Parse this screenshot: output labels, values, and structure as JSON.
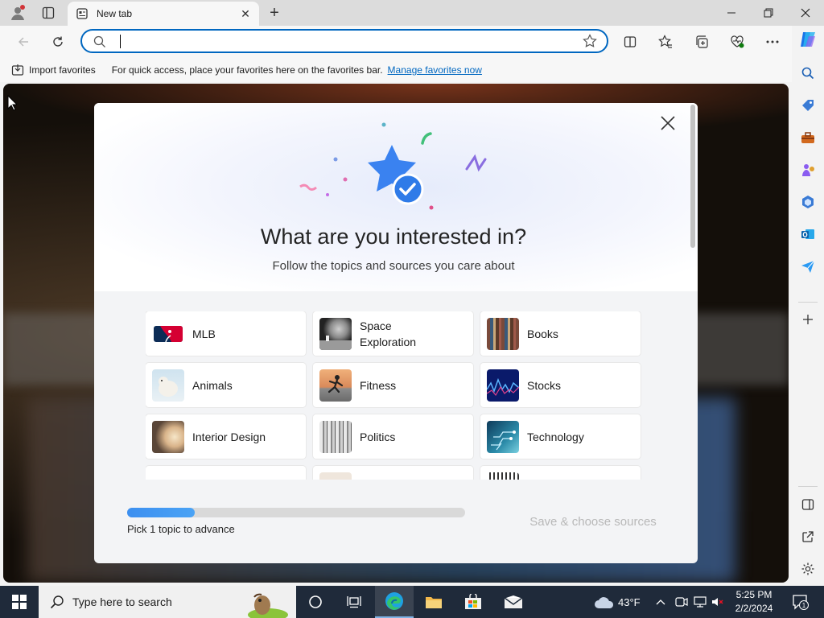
{
  "browser": {
    "tab": {
      "title": "New tab"
    },
    "address": {
      "value": "",
      "placeholder": ""
    }
  },
  "favorites_bar": {
    "import_label": "Import favorites",
    "hint": "For quick access, place your favorites here on the favorites bar.",
    "manage_link": "Manage favorites now"
  },
  "modal": {
    "title": "What are you interested in?",
    "subtitle": "Follow the topics and sources you care about",
    "topics": [
      {
        "label": "MLB",
        "icon": "mlb-logo-icon"
      },
      {
        "label": "Space Exploration",
        "icon": "moon-surface-thumb"
      },
      {
        "label": "Books",
        "icon": "bookshelf-thumb"
      },
      {
        "label": "Animals",
        "icon": "polar-bear-thumb"
      },
      {
        "label": "Fitness",
        "icon": "runner-thumb"
      },
      {
        "label": "Stocks",
        "icon": "stock-chart-thumb"
      },
      {
        "label": "Interior Design",
        "icon": "lamp-thumb"
      },
      {
        "label": "Politics",
        "icon": "columns-thumb"
      },
      {
        "label": "Technology",
        "icon": "circuit-thumb"
      }
    ],
    "progress": {
      "fraction": 0.2,
      "label": "Pick 1 topic to advance"
    },
    "save_button": "Save & choose sources"
  },
  "taskbar": {
    "search_placeholder": "Type here to search",
    "weather": "43°F",
    "time": "5:25 PM",
    "date": "2/2/2024",
    "notification_count": "1"
  },
  "colors": {
    "accent": "#0067c0",
    "progress": "#3c8ff0",
    "taskbar": "#1f2a3a"
  }
}
